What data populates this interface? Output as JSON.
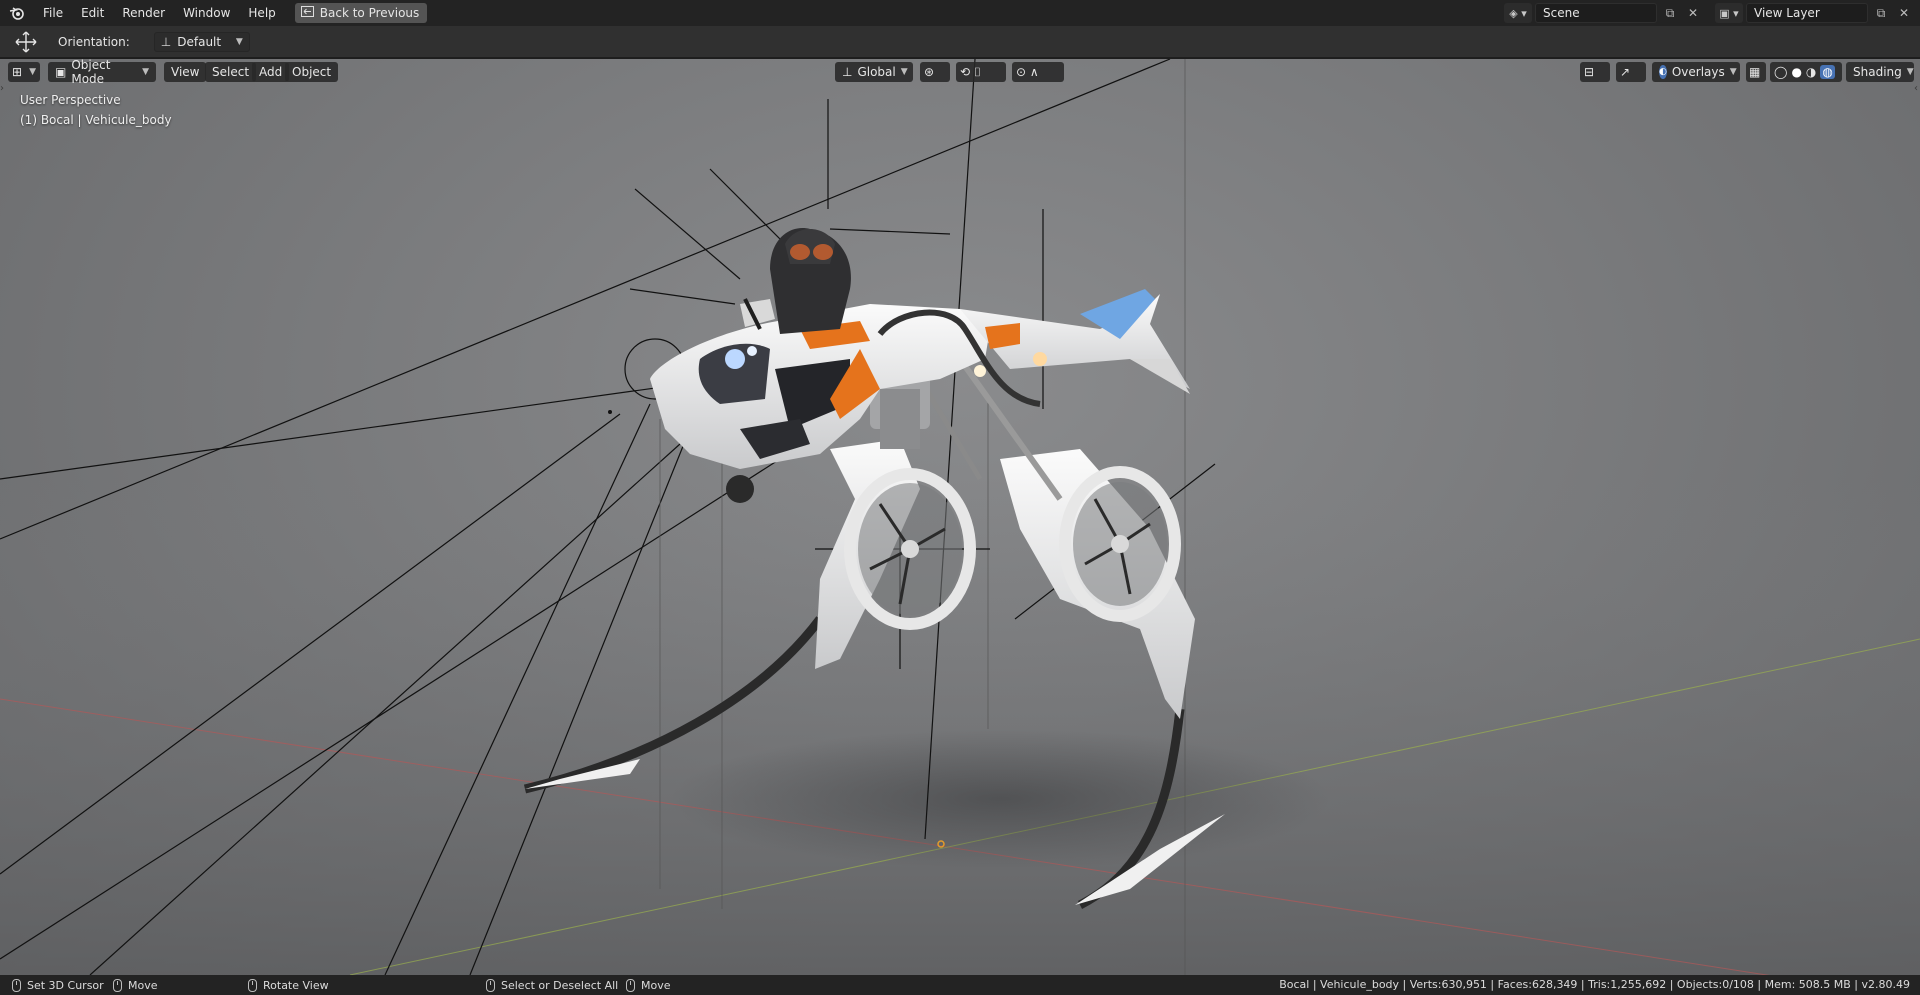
{
  "menu": {
    "items": [
      "File",
      "Edit",
      "Render",
      "Window",
      "Help"
    ],
    "back_button": "Back to Previous"
  },
  "workspace": {
    "scene_name": "Scene",
    "view_layer_name": "View Layer"
  },
  "tool_settings": {
    "orientation_label": "Orientation:",
    "orientation_value": "Default"
  },
  "viewport_header": {
    "mode": "Object Mode",
    "menus": [
      "View",
      "Select",
      "Add",
      "Object"
    ],
    "transform_orientation": "Global",
    "overlays_label": "Overlays",
    "shading_label": "Shading"
  },
  "viewport": {
    "perspective_label": "User Perspective",
    "active_object_label": "(1) Bocal | Vehicule_body"
  },
  "statusbar": {
    "left_hints": [
      {
        "action": "Set 3D Cursor"
      },
      {
        "action": "Move"
      },
      {
        "action": "Rotate View"
      },
      {
        "action": "Select or Deselect All"
      },
      {
        "action": "Move"
      }
    ],
    "stats": "Bocal | Vehicule_body | Verts:630,951 | Faces:628,349 | Tris:1,255,692 | Objects:0/108 | Mem: 508.5 MB | v2.80.49"
  },
  "colors": {
    "accent_blue": "#4772b3",
    "vehicle_orange": "#e5731c",
    "vehicle_white": "#f2f2f2",
    "axis_red": "#c45a5a",
    "axis_green": "#9aae4a"
  }
}
